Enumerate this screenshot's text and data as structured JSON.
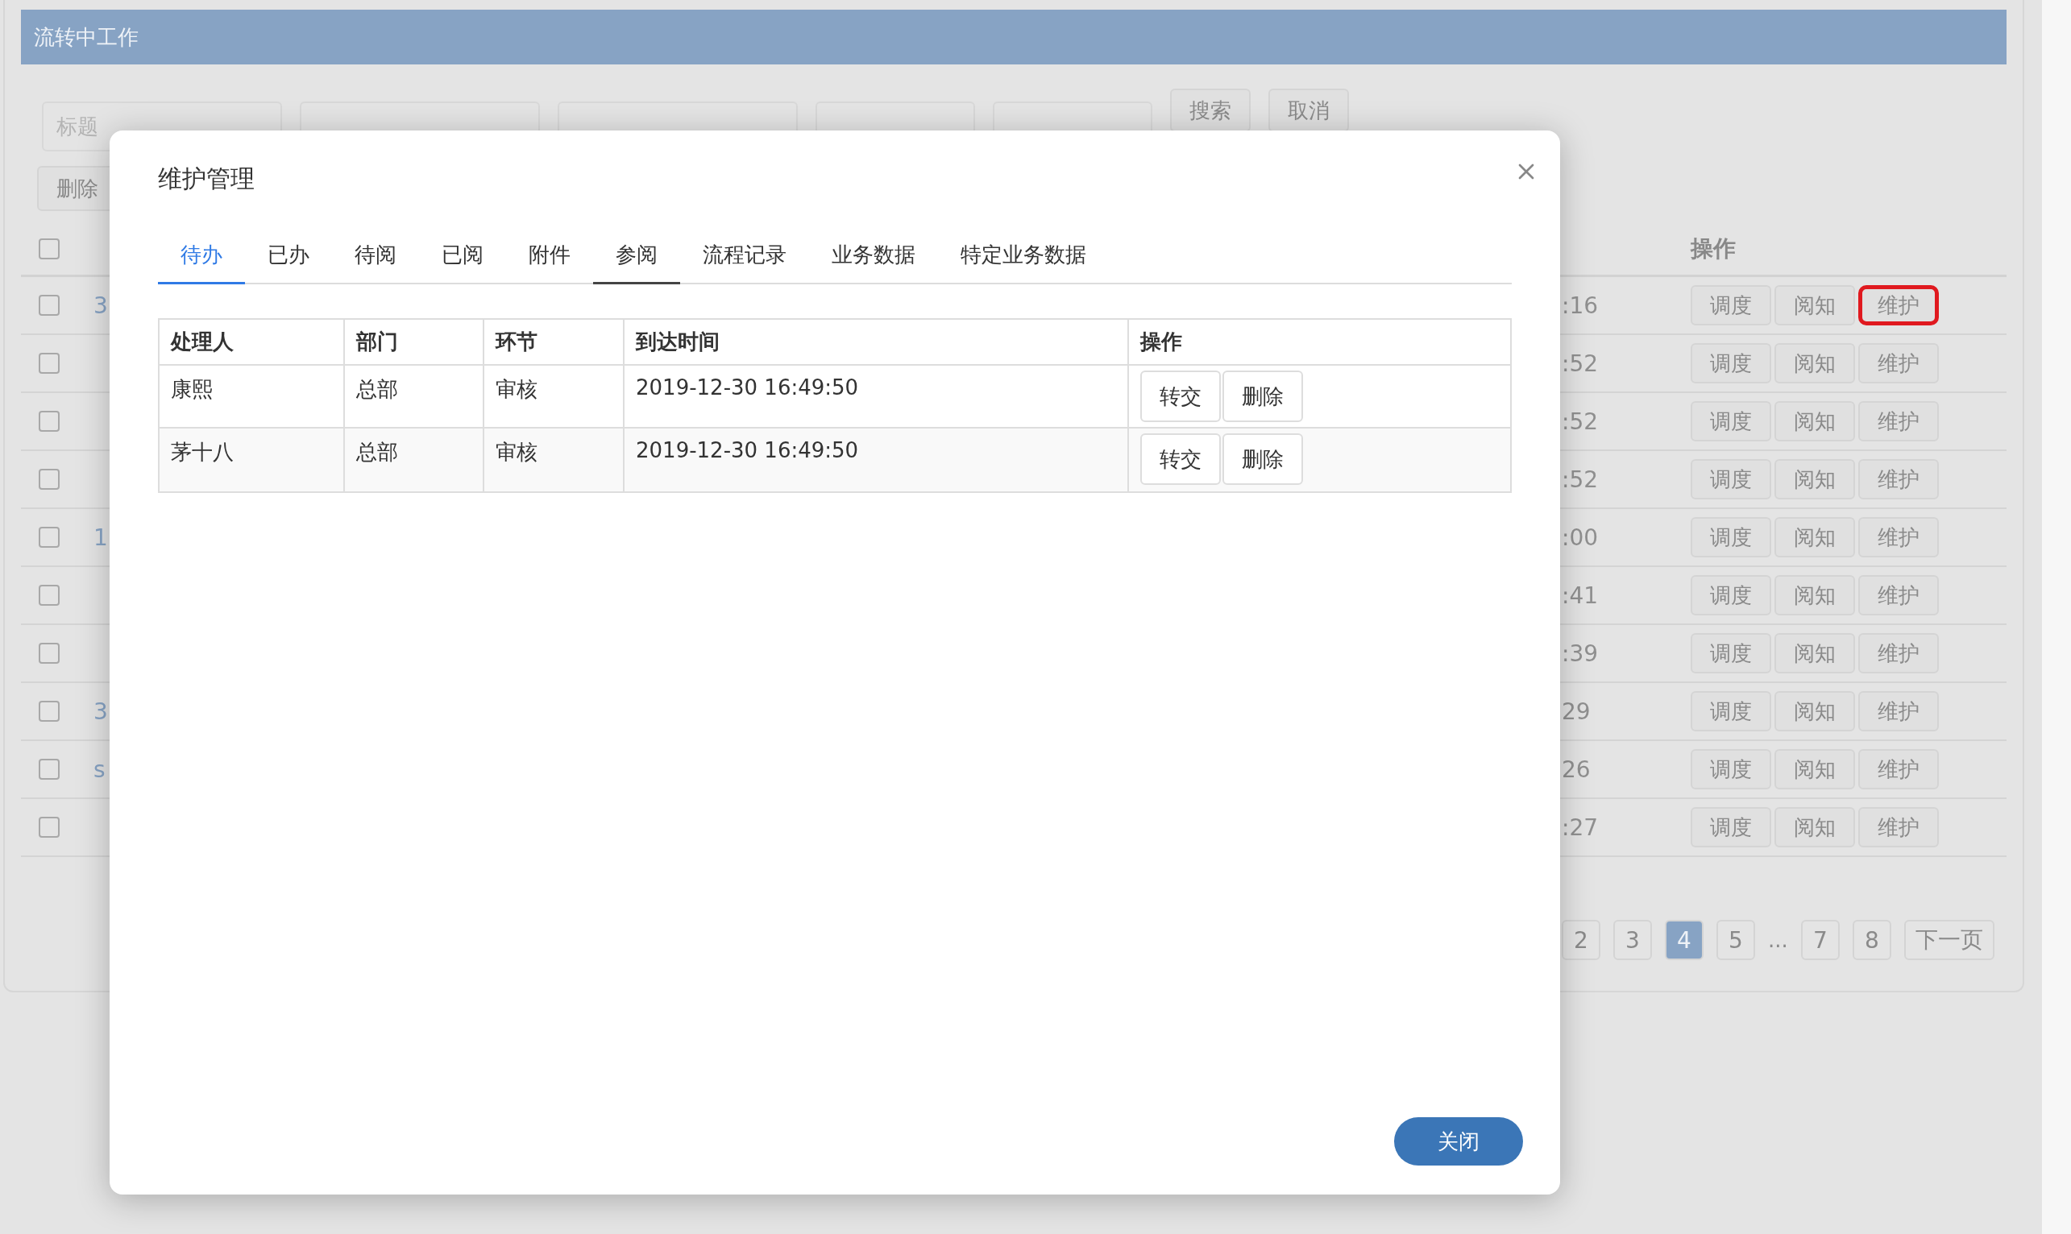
{
  "page_title": "流转中工作",
  "search": {
    "fields": [
      {
        "kind": "text",
        "placeholder": "标题"
      },
      {
        "kind": "text"
      },
      {
        "kind": "text"
      },
      {
        "kind": "date"
      },
      {
        "kind": "date"
      }
    ],
    "buttons": [
      "搜索",
      "取消"
    ]
  },
  "toolbar": {
    "buttons": [
      "删除"
    ]
  },
  "list": {
    "header_checked": false,
    "columns": [
      {
        "label": "操作"
      }
    ],
    "rows": [
      {
        "checked": false,
        "title": "3",
        "time": ":16",
        "actions": [
          {
            "label": "调度",
            "highlighted": false
          },
          {
            "label": "阅知",
            "highlighted": false
          },
          {
            "label": "维护",
            "highlighted": true
          }
        ]
      },
      {
        "checked": false,
        "time": ":52",
        "actions": [
          {
            "label": "调度",
            "highlighted": false
          },
          {
            "label": "阅知",
            "highlighted": false
          },
          {
            "label": "维护",
            "highlighted": false
          }
        ]
      },
      {
        "checked": false,
        "time": ":52",
        "actions": [
          {
            "label": "调度",
            "highlighted": false
          },
          {
            "label": "阅知",
            "highlighted": false
          },
          {
            "label": "维护",
            "highlighted": false
          }
        ]
      },
      {
        "checked": false,
        "time": ":52",
        "actions": [
          {
            "label": "调度",
            "highlighted": false
          },
          {
            "label": "阅知",
            "highlighted": false
          },
          {
            "label": "维护",
            "highlighted": false
          }
        ]
      },
      {
        "checked": false,
        "title": "1",
        "time": ":00",
        "actions": [
          {
            "label": "调度",
            "highlighted": false
          },
          {
            "label": "阅知",
            "highlighted": false
          },
          {
            "label": "维护",
            "highlighted": false
          }
        ]
      },
      {
        "checked": false,
        "time": ":41",
        "actions": [
          {
            "label": "调度",
            "highlighted": false
          },
          {
            "label": "阅知",
            "highlighted": false
          },
          {
            "label": "维护",
            "highlighted": false
          }
        ]
      },
      {
        "checked": false,
        "time": ":39",
        "actions": [
          {
            "label": "调度",
            "highlighted": false
          },
          {
            "label": "阅知",
            "highlighted": false
          },
          {
            "label": "维护",
            "highlighted": false
          }
        ]
      },
      {
        "checked": false,
        "title": "3",
        "time": "29",
        "actions": [
          {
            "label": "调度",
            "highlighted": false
          },
          {
            "label": "阅知",
            "highlighted": false
          },
          {
            "label": "维护",
            "highlighted": false
          }
        ]
      },
      {
        "checked": false,
        "title": "s",
        "time": "26",
        "actions": [
          {
            "label": "调度",
            "highlighted": false
          },
          {
            "label": "阅知",
            "highlighted": false
          },
          {
            "label": "维护",
            "highlighted": false
          }
        ]
      },
      {
        "checked": false,
        "time": ":27",
        "actions": [
          {
            "label": "调度",
            "highlighted": false
          },
          {
            "label": "阅知",
            "highlighted": false
          },
          {
            "label": "维护",
            "highlighted": false
          }
        ]
      }
    ]
  },
  "pagination": [
    {
      "kind": "page",
      "label": "2",
      "selected": false
    },
    {
      "kind": "page",
      "label": "3",
      "selected": false
    },
    {
      "kind": "page",
      "label": "4",
      "selected": true
    },
    {
      "kind": "page",
      "label": "5",
      "selected": false
    },
    {
      "kind": "ellipsis",
      "label": "..."
    },
    {
      "kind": "page",
      "label": "7",
      "selected": false
    },
    {
      "kind": "page",
      "label": "8",
      "selected": false
    },
    {
      "kind": "page",
      "label": "下一页",
      "selected": false
    }
  ],
  "modal": {
    "title": "维护管理",
    "tabs": [
      {
        "label": "待办",
        "selected": true,
        "hovered": false
      },
      {
        "label": "已办",
        "selected": false,
        "hovered": false
      },
      {
        "label": "待阅",
        "selected": false,
        "hovered": false
      },
      {
        "label": "已阅",
        "selected": false,
        "hovered": false
      },
      {
        "label": "附件",
        "selected": false,
        "hovered": false
      },
      {
        "label": "参阅",
        "selected": false,
        "hovered": true
      },
      {
        "label": "流程记录",
        "selected": false,
        "hovered": false
      },
      {
        "label": "业务数据",
        "selected": false,
        "hovered": false
      },
      {
        "label": "特定业务数据",
        "selected": false,
        "hovered": false
      }
    ],
    "table": {
      "columns": [
        "处理人",
        "部门",
        "环节",
        "到达时间",
        "操作"
      ],
      "rows": [
        {
          "cells": [
            "康熙",
            "总部",
            "审核",
            "2019-12-30 16:49:50"
          ],
          "actions": [
            "转交",
            "删除"
          ]
        },
        {
          "cells": [
            "茅十八",
            "总部",
            "审核",
            "2019-12-30 16:49:50"
          ],
          "actions": [
            "转交",
            "删除"
          ]
        }
      ]
    },
    "close_button": "关闭"
  }
}
